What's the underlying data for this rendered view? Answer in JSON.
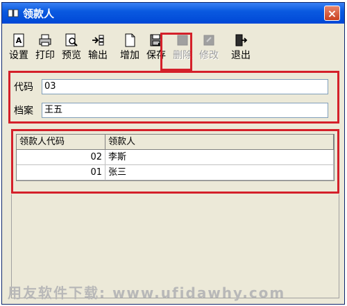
{
  "window": {
    "title": "领款人",
    "close_label": "×"
  },
  "toolbar": {
    "buttons": [
      {
        "label": "设置",
        "icon": "settings-icon"
      },
      {
        "label": "打印",
        "icon": "printer-icon"
      },
      {
        "label": "预览",
        "icon": "preview-icon"
      },
      {
        "label": "输出",
        "icon": "export-icon"
      },
      {
        "label": "增加",
        "icon": "add-icon"
      },
      {
        "label": "保存",
        "icon": "save-icon"
      },
      {
        "label": "删除",
        "icon": "delete-icon",
        "disabled": true
      },
      {
        "label": "修改",
        "icon": "edit-icon",
        "disabled": true
      },
      {
        "label": "退出",
        "icon": "exit-icon"
      }
    ]
  },
  "form": {
    "code_label": "代码",
    "code_value": "03",
    "name_label": "档案",
    "name_value": "王五"
  },
  "grid": {
    "headers": [
      "领款人代码",
      "领款人"
    ],
    "rows": [
      {
        "code": "02",
        "name": "李斯"
      },
      {
        "code": "01",
        "name": "张三"
      }
    ]
  },
  "watermark": "用友软件下载: www.ufidawhy.com",
  "colors": {
    "highlight": "#d4202a",
    "titlebar": "#0a5ae0"
  }
}
